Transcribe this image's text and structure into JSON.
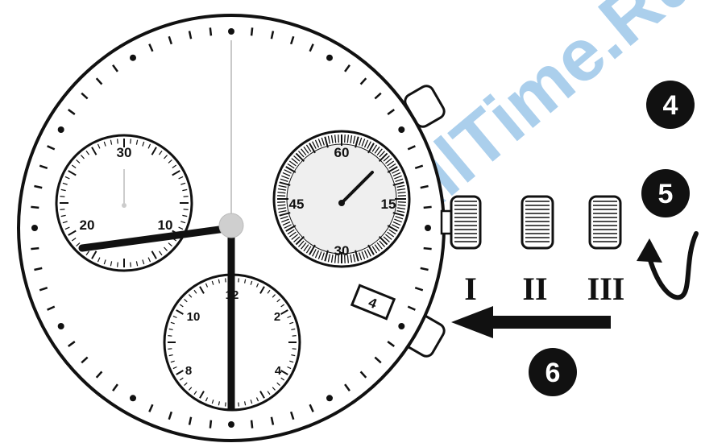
{
  "watermark": {
    "text": "AllTime.Ru",
    "color": "#8fbfe6"
  },
  "left_subdial": {
    "labels": [
      "30",
      "20",
      "10"
    ]
  },
  "right_subdial": {
    "labels": [
      "60",
      "45",
      "15",
      "30"
    ]
  },
  "bottom_subdial": {
    "labels": [
      "12",
      "10",
      "2",
      "8",
      "4"
    ]
  },
  "date_window": {
    "value": "4"
  },
  "crown_positions": [
    "I",
    "II",
    "III"
  ],
  "steps": [
    {
      "number": "4"
    },
    {
      "number": "5"
    },
    {
      "number": "6"
    }
  ],
  "colors": {
    "ink": "#111111",
    "paper": "#ffffff",
    "center_cap": "#cfcfcf"
  }
}
